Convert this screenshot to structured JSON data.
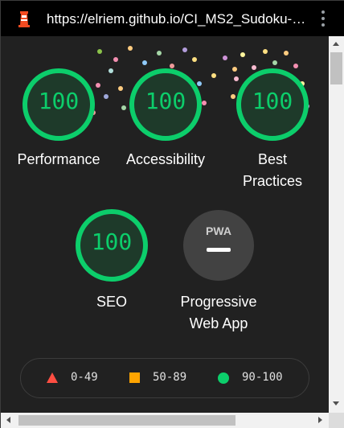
{
  "browser": {
    "url": "https://elriem.github.io/CI_MS2_Sudoku-…",
    "favicon": "lighthouse-icon",
    "menu_icon": "more-vertical-icon"
  },
  "report": {
    "categories": [
      {
        "label": "Performance",
        "score": "100"
      },
      {
        "label": "Accessibility",
        "score": "100"
      },
      {
        "label": "Best\nPractices",
        "score": "100"
      },
      {
        "label": "SEO",
        "score": "100"
      }
    ],
    "pwa": {
      "badge_text": "PWA",
      "label": "Progressive\nWeb App"
    },
    "legend": [
      {
        "range": "0-49",
        "color": "#ff4e42",
        "shape": "triangle"
      },
      {
        "range": "50-89",
        "color": "#ffa400",
        "shape": "square"
      },
      {
        "range": "90-100",
        "color": "#0cce6b",
        "shape": "circle"
      }
    ]
  },
  "colors": {
    "pass_green": "#0cce6b",
    "background": "#212121"
  }
}
